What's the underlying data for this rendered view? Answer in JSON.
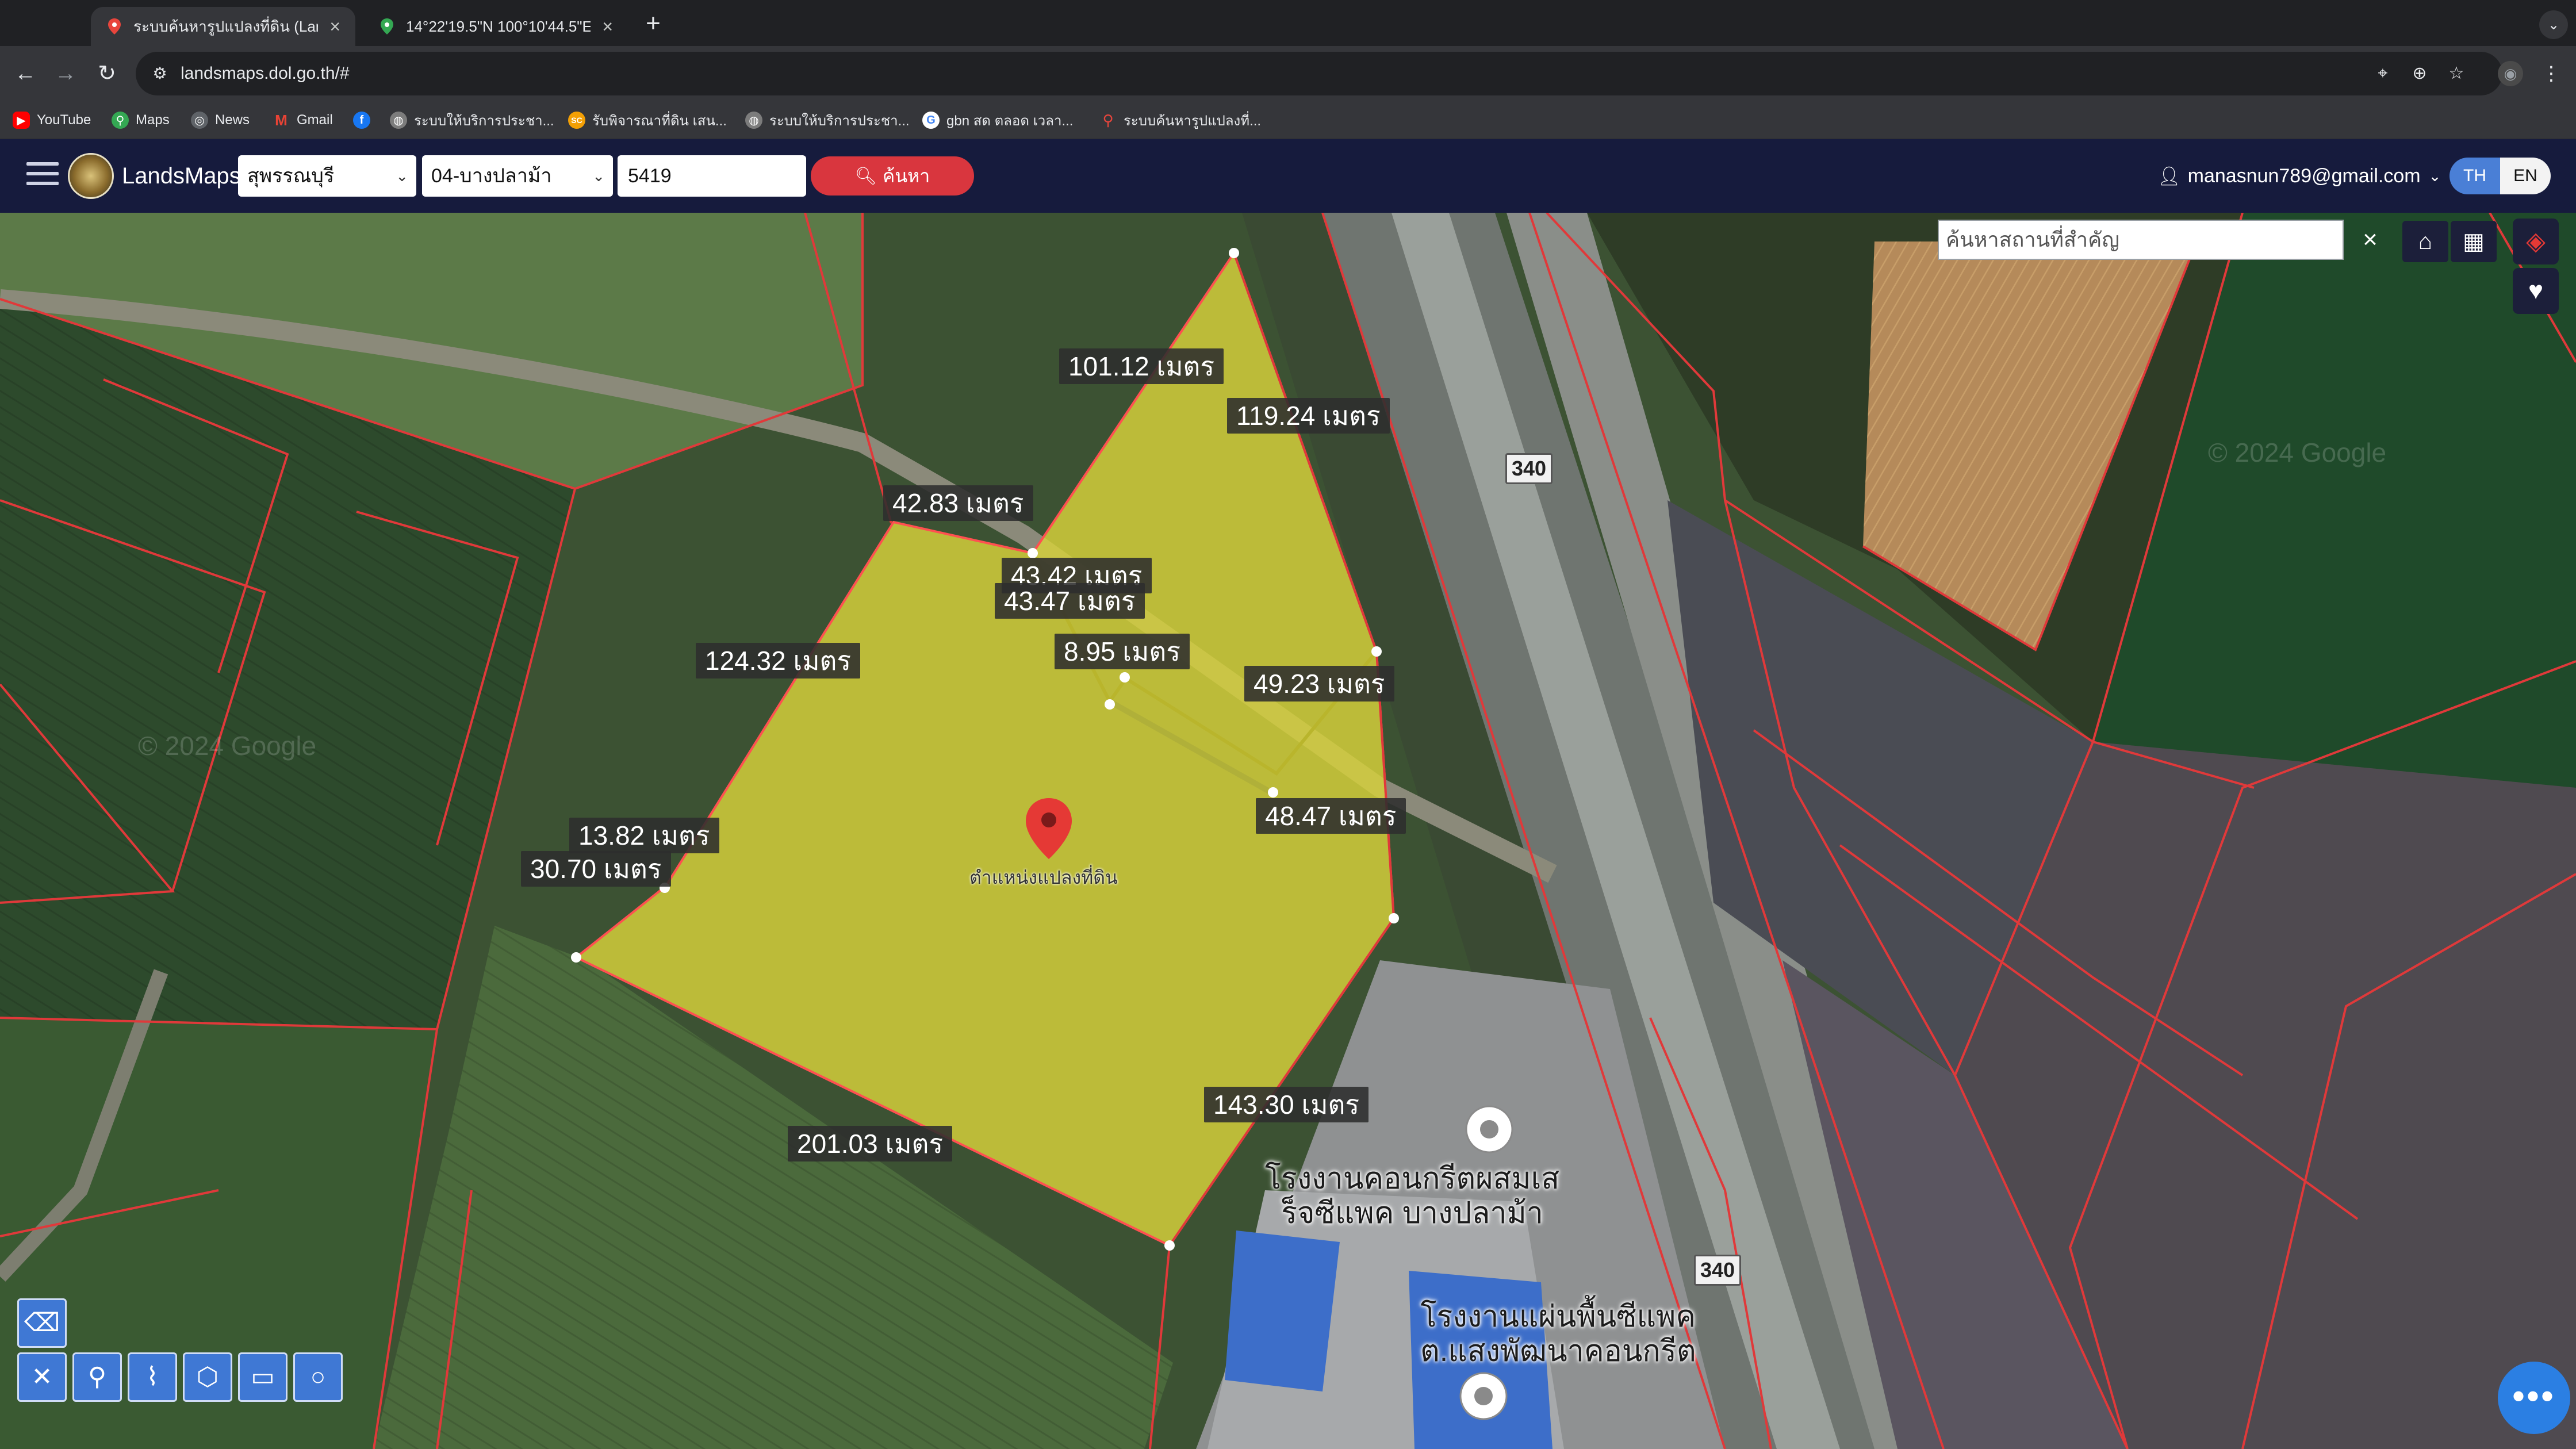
{
  "browser": {
    "tabs": [
      {
        "title": "ระบบค้นหารูปแปลงที่ดิน (LandsMaps)",
        "active": true
      },
      {
        "title": "14°22'19.5\"N 100°10'44.5\"E",
        "active": false
      }
    ],
    "url": "landsmaps.dol.go.th/#",
    "bookmarks": [
      {
        "label": "YouTube",
        "icon": "youtube-icon"
      },
      {
        "label": "Maps",
        "icon": "maps-pin-icon"
      },
      {
        "label": "News",
        "icon": "news-icon"
      },
      {
        "label": "Gmail",
        "icon": "gmail-icon"
      },
      {
        "label": "",
        "icon": "facebook-icon"
      },
      {
        "label": "ระบบให้บริการประชา...",
        "icon": "site-icon"
      },
      {
        "label": "รับพิจารณาที่ดิน เสน...",
        "icon": "sc-icon"
      },
      {
        "label": "ระบบให้บริการประชา...",
        "icon": "site-icon"
      },
      {
        "label": "gbn สด ตลอด เวลา...",
        "icon": "google-icon"
      },
      {
        "label": "ระบบค้นหารูปแปลงที่...",
        "icon": "maps-pin-icon"
      }
    ]
  },
  "app": {
    "brand": "LandsMaps",
    "province": "สุพรรณบุรี",
    "district": "04-บางปลาม้า",
    "parcel_number": "5419",
    "search_label": "ค้นหา",
    "user_email": "manasnun789@gmail.com",
    "lang_th": "TH",
    "lang_en": "EN"
  },
  "map": {
    "place_search_placeholder": "ค้นหาสถานที่สำคัญ",
    "measurements": [
      {
        "text": "101.12 เมตร"
      },
      {
        "text": "119.24 เมตร"
      },
      {
        "text": "42.83 เมตร"
      },
      {
        "text": "43.42 เมตร"
      },
      {
        "text": "43.47 เมตร"
      },
      {
        "text": "124.32 เมตร"
      },
      {
        "text": "8.95 เมตร"
      },
      {
        "text": "49.23 เมตร"
      },
      {
        "text": "48.47 เมตร"
      },
      {
        "text": "13.82 เมตร"
      },
      {
        "text": "30.70 เมตร"
      },
      {
        "text": "201.03 เมตร"
      },
      {
        "text": "143.30 เมตร"
      }
    ],
    "pin_caption": "ตำแหน่งแปลงที่ดิน",
    "road_number": "340",
    "poi": [
      {
        "line1": "โรงงานคอนกรีตผสมเส",
        "line2": "ร็จซีแพค บางปลาม้า"
      },
      {
        "line1": "โรงงานแผ่นพื้นซีแพค",
        "line2": "ต.แสงพัฒนาคอนกรีต"
      }
    ],
    "watermark": "© 2024 Google",
    "colors": {
      "parcel_fill": "#d8d23a",
      "parcel_border": "#e23b3b",
      "boundary": "#e0393a",
      "accent": "#3f78d4"
    }
  }
}
